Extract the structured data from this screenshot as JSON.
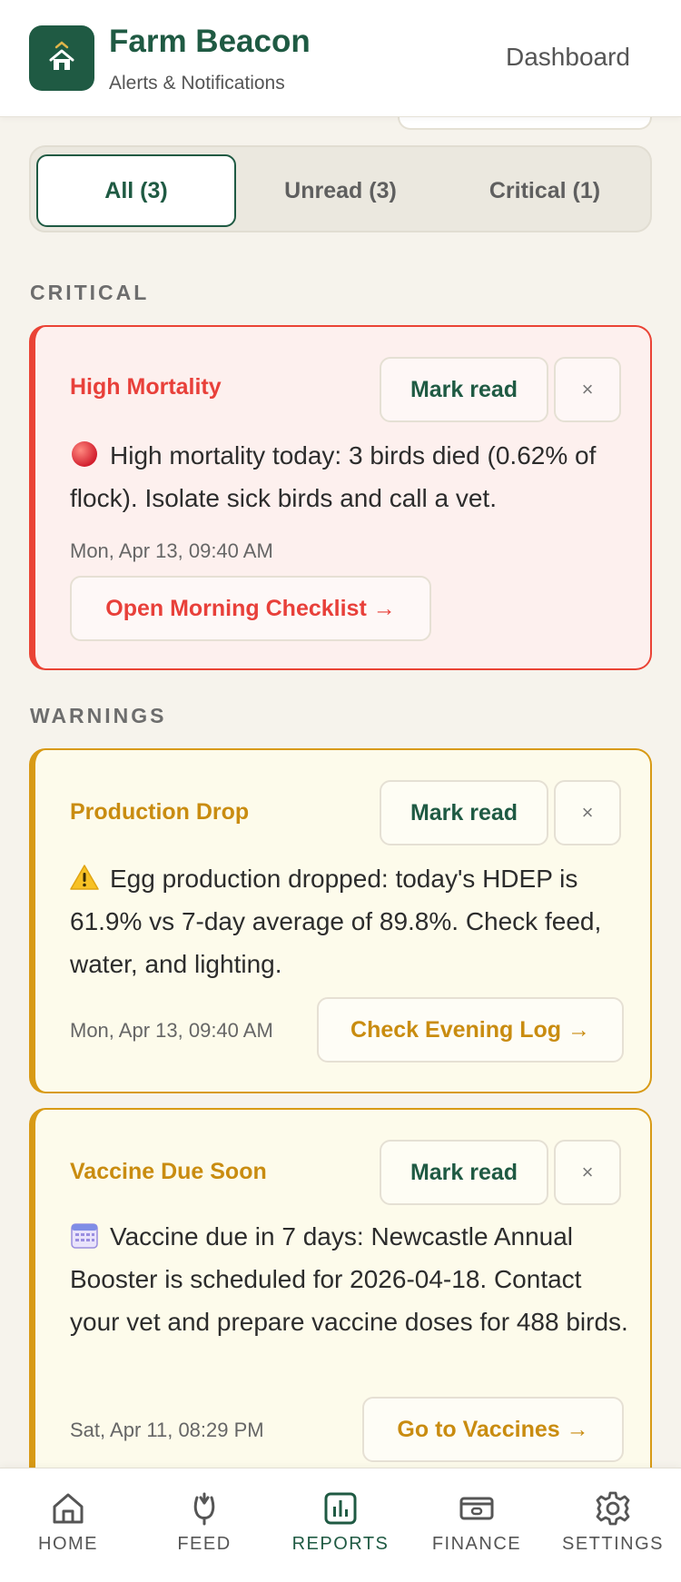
{
  "header": {
    "app_title": "Farm Beacon",
    "subtitle": "Alerts & Notifications",
    "dashboard_link": "Dashboard"
  },
  "filters": [
    {
      "label": "All (3)",
      "active": true
    },
    {
      "label": "Unread (3)",
      "active": false
    },
    {
      "label": "Critical (1)",
      "active": false
    }
  ],
  "sections": {
    "critical": "CRITICAL",
    "warnings": "WARNINGS"
  },
  "alerts": [
    {
      "severity": "critical",
      "title": "High Mortality",
      "icon": "red-circle-icon",
      "message": "High mortality today: 3 birds died (0.62% of flock). Isolate sick birds and call a vet.",
      "time": "Mon, Apr 13, 09:40 AM",
      "action": "Open Morning Checklist →",
      "mark_read": "Mark read",
      "close": "×"
    },
    {
      "severity": "warning",
      "title": "Production Drop",
      "icon": "warning-icon",
      "message": "Egg production dropped: today's HDEP is 61.9% vs 7-day average of 89.8%. Check feed, water, and lighting.",
      "time": "Mon, Apr 13, 09:40 AM",
      "action": "Check Evening Log →",
      "mark_read": "Mark read",
      "close": "×"
    },
    {
      "severity": "warning",
      "title": "Vaccine Due Soon",
      "icon": "calendar-icon",
      "message": "Vaccine due in 7 days: Newcastle Annual Booster is scheduled for 2026-04-18. Contact your vet and prepare vaccine doses for 488 birds.",
      "time": "Sat, Apr 11, 08:29 PM",
      "action": "Go to Vaccines →",
      "mark_read": "Mark read",
      "close": "×"
    }
  ],
  "nav": [
    {
      "label": "HOME",
      "icon": "home-icon",
      "active": false
    },
    {
      "label": "FEED",
      "icon": "feed-icon",
      "active": false
    },
    {
      "label": "REPORTS",
      "icon": "reports-icon",
      "active": true
    },
    {
      "label": "FINANCE",
      "icon": "finance-icon",
      "active": false
    },
    {
      "label": "SETTINGS",
      "icon": "settings-icon",
      "active": false
    }
  ],
  "colors": {
    "brand": "#1f5a43",
    "critical": "#e8403a",
    "warning": "#c98c10",
    "background": "#f6f3ec"
  }
}
